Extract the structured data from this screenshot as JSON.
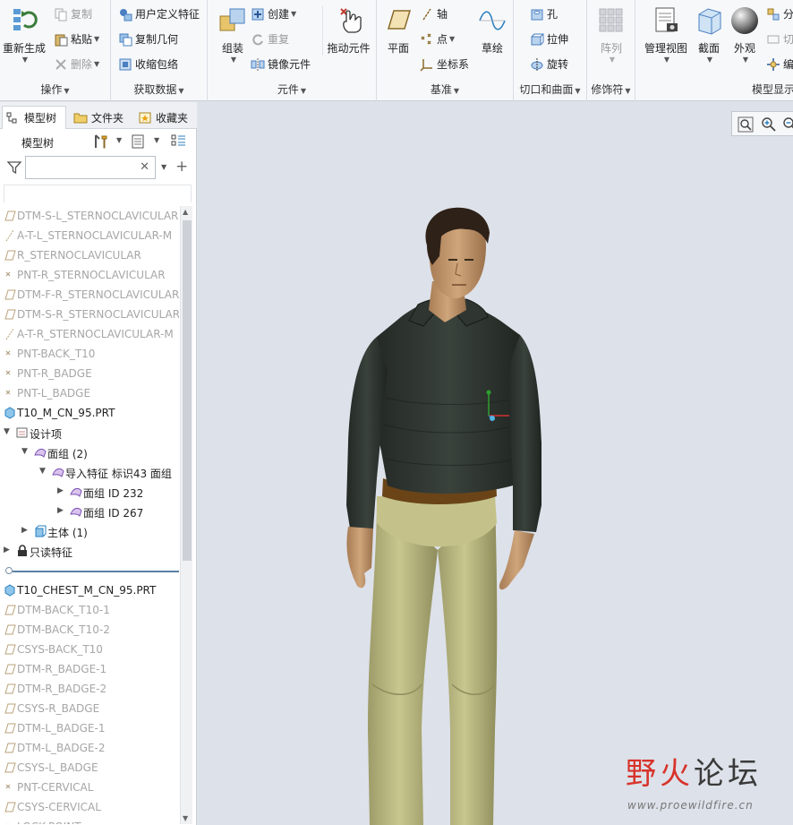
{
  "ribbon": {
    "operations": {
      "regenerate": "重新生成",
      "copy": "复制",
      "paste": "粘贴",
      "delete": "删除",
      "group_label": "操作"
    },
    "get_data": {
      "udf": "用户定义特征",
      "copy_geometry": "复制几何",
      "shrinkwrap": "收缩包络",
      "group_label": "获取数据"
    },
    "components": {
      "assemble": "组装",
      "create": "创建",
      "repeat": "重复",
      "mirror": "镜像元件",
      "drag": "拖动元件",
      "group_label": "元件"
    },
    "datum": {
      "plane": "平面",
      "axis": "轴",
      "point": "点",
      "csys": "坐标系",
      "sketch": "草绘",
      "group_label": "基准"
    },
    "cut_surface": {
      "hole": "孔",
      "extrude": "拉伸",
      "revolve": "旋转",
      "group_label": "切口和曲面"
    },
    "modifiers": {
      "pattern": "阵列",
      "group_label": "修饰符"
    },
    "model_display": {
      "manage_views": "管理视图",
      "section": "截面",
      "appearance": "外观",
      "more1": "分",
      "more2": "切",
      "more3": "编",
      "group_label": "模型显示"
    }
  },
  "panel": {
    "tabs": [
      "模型树",
      "文件夹",
      "收藏夹"
    ],
    "title": "模型树",
    "search_placeholder": ""
  },
  "tree": [
    {
      "label": "DTM-S-L_STERNOCLAVICULAR",
      "dim": true,
      "indent": 0,
      "icon": "datum-plane-icon"
    },
    {
      "label": "A-T-L_STERNOCLAVICULAR-M",
      "dim": true,
      "indent": 0,
      "icon": "axis-icon"
    },
    {
      "label": "R_STERNOCLAVICULAR",
      "dim": true,
      "indent": 0,
      "icon": "datum-plane-icon"
    },
    {
      "label": "PNT-R_STERNOCLAVICULAR",
      "dim": true,
      "indent": 0,
      "icon": "point-icon"
    },
    {
      "label": "DTM-F-R_STERNOCLAVICULAR",
      "dim": true,
      "indent": 0,
      "icon": "datum-plane-icon"
    },
    {
      "label": "DTM-S-R_STERNOCLAVICULAR",
      "dim": true,
      "indent": 0,
      "icon": "datum-plane-icon"
    },
    {
      "label": "A-T-R_STERNOCLAVICULAR-M",
      "dim": true,
      "indent": 0,
      "icon": "axis-icon"
    },
    {
      "label": "PNT-BACK_T10",
      "dim": true,
      "indent": 0,
      "icon": "point-icon"
    },
    {
      "label": "PNT-R_BADGE",
      "dim": true,
      "indent": 0,
      "icon": "point-icon"
    },
    {
      "label": "PNT-L_BADGE",
      "dim": true,
      "indent": 0,
      "icon": "point-icon"
    },
    {
      "label": "T10_M_CN_95.PRT",
      "dim": false,
      "indent": 0,
      "icon": "part-icon"
    },
    {
      "label": "设计项",
      "dim": false,
      "indent": 0,
      "icon": "design-item-icon",
      "expand": "▼"
    },
    {
      "label": "面组 (2)",
      "dim": false,
      "indent": 1,
      "icon": "quilt-icon",
      "expand": "▼"
    },
    {
      "label": "导入特征 标识43 面组",
      "dim": false,
      "indent": 2,
      "icon": "quilt-icon",
      "expand": "▼"
    },
    {
      "label": "面组 ID 232",
      "dim": false,
      "indent": 3,
      "icon": "quilt-icon",
      "expand": "▶"
    },
    {
      "label": "面组 ID 267",
      "dim": false,
      "indent": 3,
      "icon": "quilt-icon",
      "expand": "▶"
    },
    {
      "label": "主体 (1)",
      "dim": false,
      "indent": 1,
      "icon": "body-icon",
      "expand": "▶"
    },
    {
      "label": "只读特征",
      "dim": false,
      "indent": 0,
      "icon": "lock-icon",
      "expand": "▶"
    },
    {
      "label": "",
      "dim": false,
      "indent": 0,
      "icon": "insert-marker",
      "separator": true
    },
    {
      "label": "T10_CHEST_M_CN_95.PRT",
      "dim": false,
      "indent": 0,
      "icon": "part-icon"
    },
    {
      "label": "DTM-BACK_T10-1",
      "dim": true,
      "indent": 0,
      "icon": "datum-plane-icon"
    },
    {
      "label": "DTM-BACK_T10-2",
      "dim": true,
      "indent": 0,
      "icon": "datum-plane-icon"
    },
    {
      "label": "CSYS-BACK_T10",
      "dim": true,
      "indent": 0,
      "icon": "datum-plane-icon"
    },
    {
      "label": "DTM-R_BADGE-1",
      "dim": true,
      "indent": 0,
      "icon": "datum-plane-icon"
    },
    {
      "label": "DTM-R_BADGE-2",
      "dim": true,
      "indent": 0,
      "icon": "datum-plane-icon"
    },
    {
      "label": "CSYS-R_BADGE",
      "dim": true,
      "indent": 0,
      "icon": "datum-plane-icon"
    },
    {
      "label": "DTM-L_BADGE-1",
      "dim": true,
      "indent": 0,
      "icon": "datum-plane-icon"
    },
    {
      "label": "DTM-L_BADGE-2",
      "dim": true,
      "indent": 0,
      "icon": "datum-plane-icon"
    },
    {
      "label": "CSYS-L_BADGE",
      "dim": true,
      "indent": 0,
      "icon": "datum-plane-icon"
    },
    {
      "label": "PNT-CERVICAL",
      "dim": true,
      "indent": 0,
      "icon": "point-icon"
    },
    {
      "label": "CSYS-CERVICAL",
      "dim": true,
      "indent": 0,
      "icon": "datum-plane-icon"
    },
    {
      "label": "LOCK-POINT",
      "dim": true,
      "indent": 0,
      "icon": "point-icon"
    }
  ],
  "watermark": {
    "text_red": "野火",
    "text_dark": "论坛",
    "url": "www.proewildfire.cn"
  },
  "colors": {
    "shirt": "#2b312d",
    "pants": "#bfbd86",
    "skin": "#c49a70",
    "belt": "#6a4417",
    "hair": "#2e2118"
  }
}
